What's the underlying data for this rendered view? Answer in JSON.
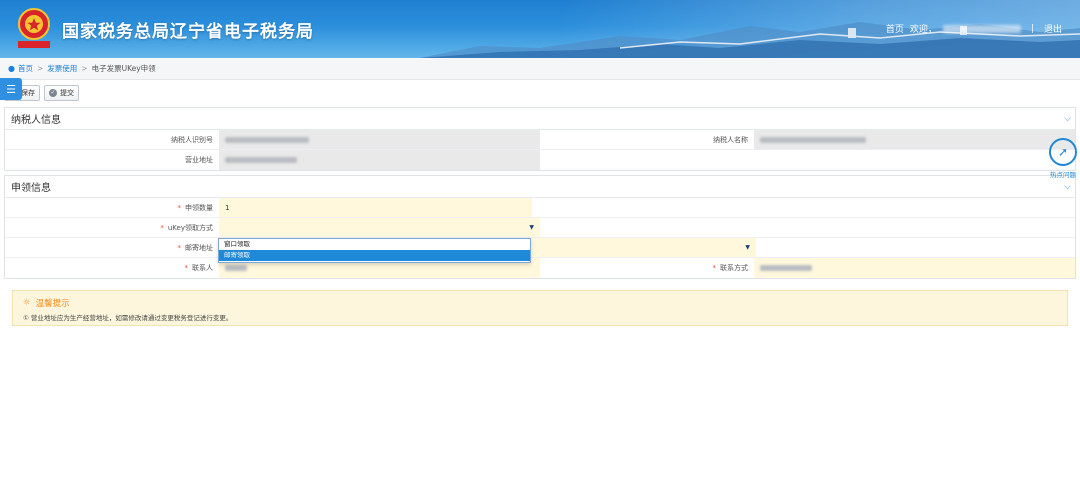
{
  "header": {
    "site_title": "国家税务总局辽宁省电子税务局",
    "nav_home": "首页",
    "nav_welcome": "欢迎，",
    "nav_separator": "|",
    "nav_logout": "退出"
  },
  "breadcrumb": {
    "items": [
      "首页",
      "发票使用",
      "电子发票UKey申领"
    ]
  },
  "toolbar": {
    "menu_icon": "menu-icon",
    "save_label": "保存",
    "submit_label": "提交"
  },
  "taxpayer": {
    "title": "纳税人信息",
    "id_label": "纳税人识别号",
    "name_label": "纳税人名称",
    "address_label": "营业地址"
  },
  "application": {
    "title": "申领信息",
    "quantity_label": "申领数量",
    "quantity_value": "1",
    "method_label": "uKey领取方式",
    "mail_address_label": "邮寄地址",
    "contact_label": "联系人",
    "contact_phone_label": "联系方式",
    "method_options": [
      "窗口领取",
      "邮寄领取"
    ],
    "method_highlighted": "邮寄领取"
  },
  "tip": {
    "title": "温馨提示",
    "text": "① 营业地址应为生产经营地址，如需修改请通过变更税务登记进行变更。"
  },
  "hot_question": {
    "label": "热点问题"
  },
  "colors": {
    "header_blue": "#2b8fdc",
    "accent_blue": "#1e88d9",
    "required_star": "#e24a2f",
    "tip_orange": "#f08a1c"
  }
}
